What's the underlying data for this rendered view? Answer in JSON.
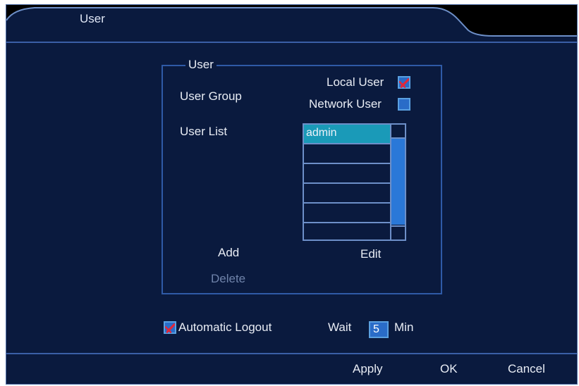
{
  "window": {
    "title": "User"
  },
  "groupbox": {
    "title": "User"
  },
  "user_group": {
    "label": "User Group",
    "local_user_label": "Local User",
    "local_user_checked": true,
    "network_user_label": "Network User",
    "network_user_checked": false
  },
  "user_list": {
    "label": "User List",
    "items": [
      "admin",
      "",
      "",
      "",
      ""
    ],
    "selected": "admin"
  },
  "actions": {
    "add": "Add",
    "edit": "Edit",
    "delete": "Delete"
  },
  "auto_logout": {
    "label": "Automatic Logout",
    "checked": true,
    "wait_label": "Wait",
    "wait_value": "5",
    "unit": "Min"
  },
  "footer": {
    "apply": "Apply",
    "ok": "OK",
    "cancel": "Cancel"
  },
  "colors": {
    "background": "#0a1a3e",
    "border": "#2f5aa6",
    "selection": "#1a9ab8",
    "checkbox_fill": "#2a6cc8",
    "check_mark": "#e0283a"
  }
}
